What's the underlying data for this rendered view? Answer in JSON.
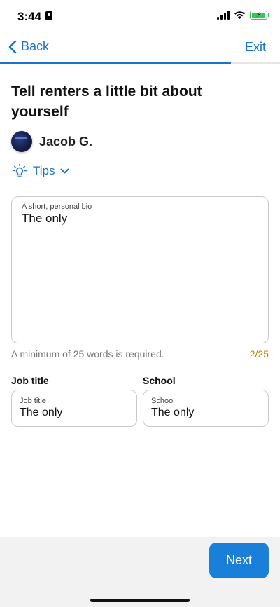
{
  "status_bar": {
    "time": "3:44",
    "icons": [
      "person-card-icon",
      "signal-icon",
      "wifi-icon",
      "battery-charging-icon"
    ],
    "battery_color": "#34c759"
  },
  "nav": {
    "back_label": "Back",
    "exit_label": "Exit",
    "accent_color": "#1a73c9"
  },
  "page": {
    "title": "Tell renters a little bit about yourself"
  },
  "profile": {
    "name": "Jacob G."
  },
  "tips": {
    "label": "Tips"
  },
  "bio": {
    "label": "A short, personal bio",
    "value": "The only",
    "helper": "A minimum of 25 words is required.",
    "counter": "2/25",
    "counter_color": "#b8860b"
  },
  "job": {
    "heading": "Job title",
    "label": "Job title",
    "value": "The only"
  },
  "school": {
    "heading": "School",
    "label": "School",
    "value": "The only"
  },
  "footer": {
    "next_label": "Next",
    "button_color": "#1a7fd9"
  }
}
